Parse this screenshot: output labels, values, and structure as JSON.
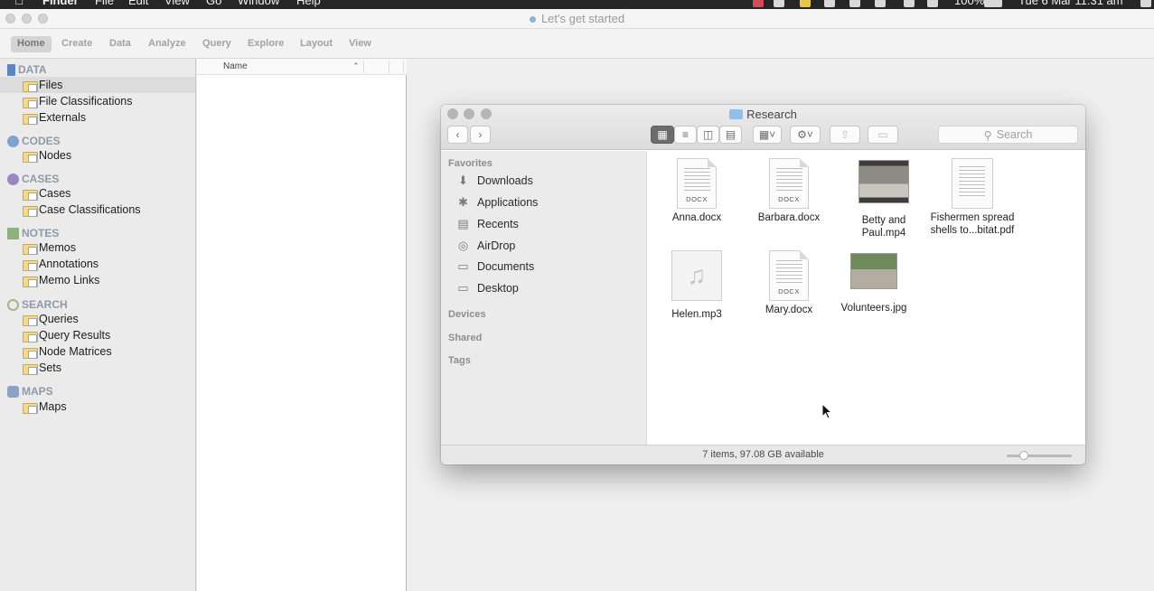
{
  "menubar": {
    "app_name": "Finder",
    "menus": [
      "File",
      "Edit",
      "View",
      "Go",
      "Window",
      "Help"
    ],
    "battery": "100%",
    "clock": "Tue 6 Mar  11:31 am"
  },
  "nvivo": {
    "window_title": "Let's get started",
    "ribbon_tabs": [
      "Home",
      "Create",
      "Data",
      "Analyze",
      "Query",
      "Explore",
      "Layout",
      "View"
    ],
    "list_column_name": "Name",
    "nav": {
      "data": {
        "heading": "DATA",
        "items": [
          "Files",
          "File Classifications",
          "Externals"
        ]
      },
      "codes": {
        "heading": "CODES",
        "items": [
          "Nodes"
        ]
      },
      "cases": {
        "heading": "CASES",
        "items": [
          "Cases",
          "Case Classifications"
        ]
      },
      "notes": {
        "heading": "NOTES",
        "items": [
          "Memos",
          "Annotations",
          "Memo Links"
        ]
      },
      "search": {
        "heading": "SEARCH",
        "items": [
          "Queries",
          "Query Results",
          "Node Matrices",
          "Sets"
        ]
      },
      "maps": {
        "heading": "MAPS",
        "items": [
          "Maps"
        ]
      }
    }
  },
  "finder": {
    "title": "Research",
    "search_placeholder": "Search",
    "sidebar": {
      "favorites_heading": "Favorites",
      "favorites": [
        "Downloads",
        "Applications",
        "Recents",
        "AirDrop",
        "Documents",
        "Desktop"
      ],
      "devices_heading": "Devices",
      "shared_heading": "Shared",
      "tags_heading": "Tags"
    },
    "files": [
      {
        "name": "Anna.docx",
        "kind": "docx",
        "ext": "DOCX"
      },
      {
        "name": "Barbara.docx",
        "kind": "docx",
        "ext": "DOCX"
      },
      {
        "name": "Betty and Paul.mp4",
        "kind": "video"
      },
      {
        "name": "Fishermen spread shells to...bitat.pdf",
        "kind": "pdf"
      },
      {
        "name": "Helen.mp3",
        "kind": "audio"
      },
      {
        "name": "Mary.docx",
        "kind": "docx",
        "ext": "DOCX"
      },
      {
        "name": "Volunteers.jpg",
        "kind": "image"
      }
    ],
    "status": "7 items, 97.08 GB available"
  },
  "colors": {
    "selected_view_button": "#6c6c6c",
    "folder_blue": "#8fc0ea",
    "nav_heading": "#8e9aa8"
  }
}
